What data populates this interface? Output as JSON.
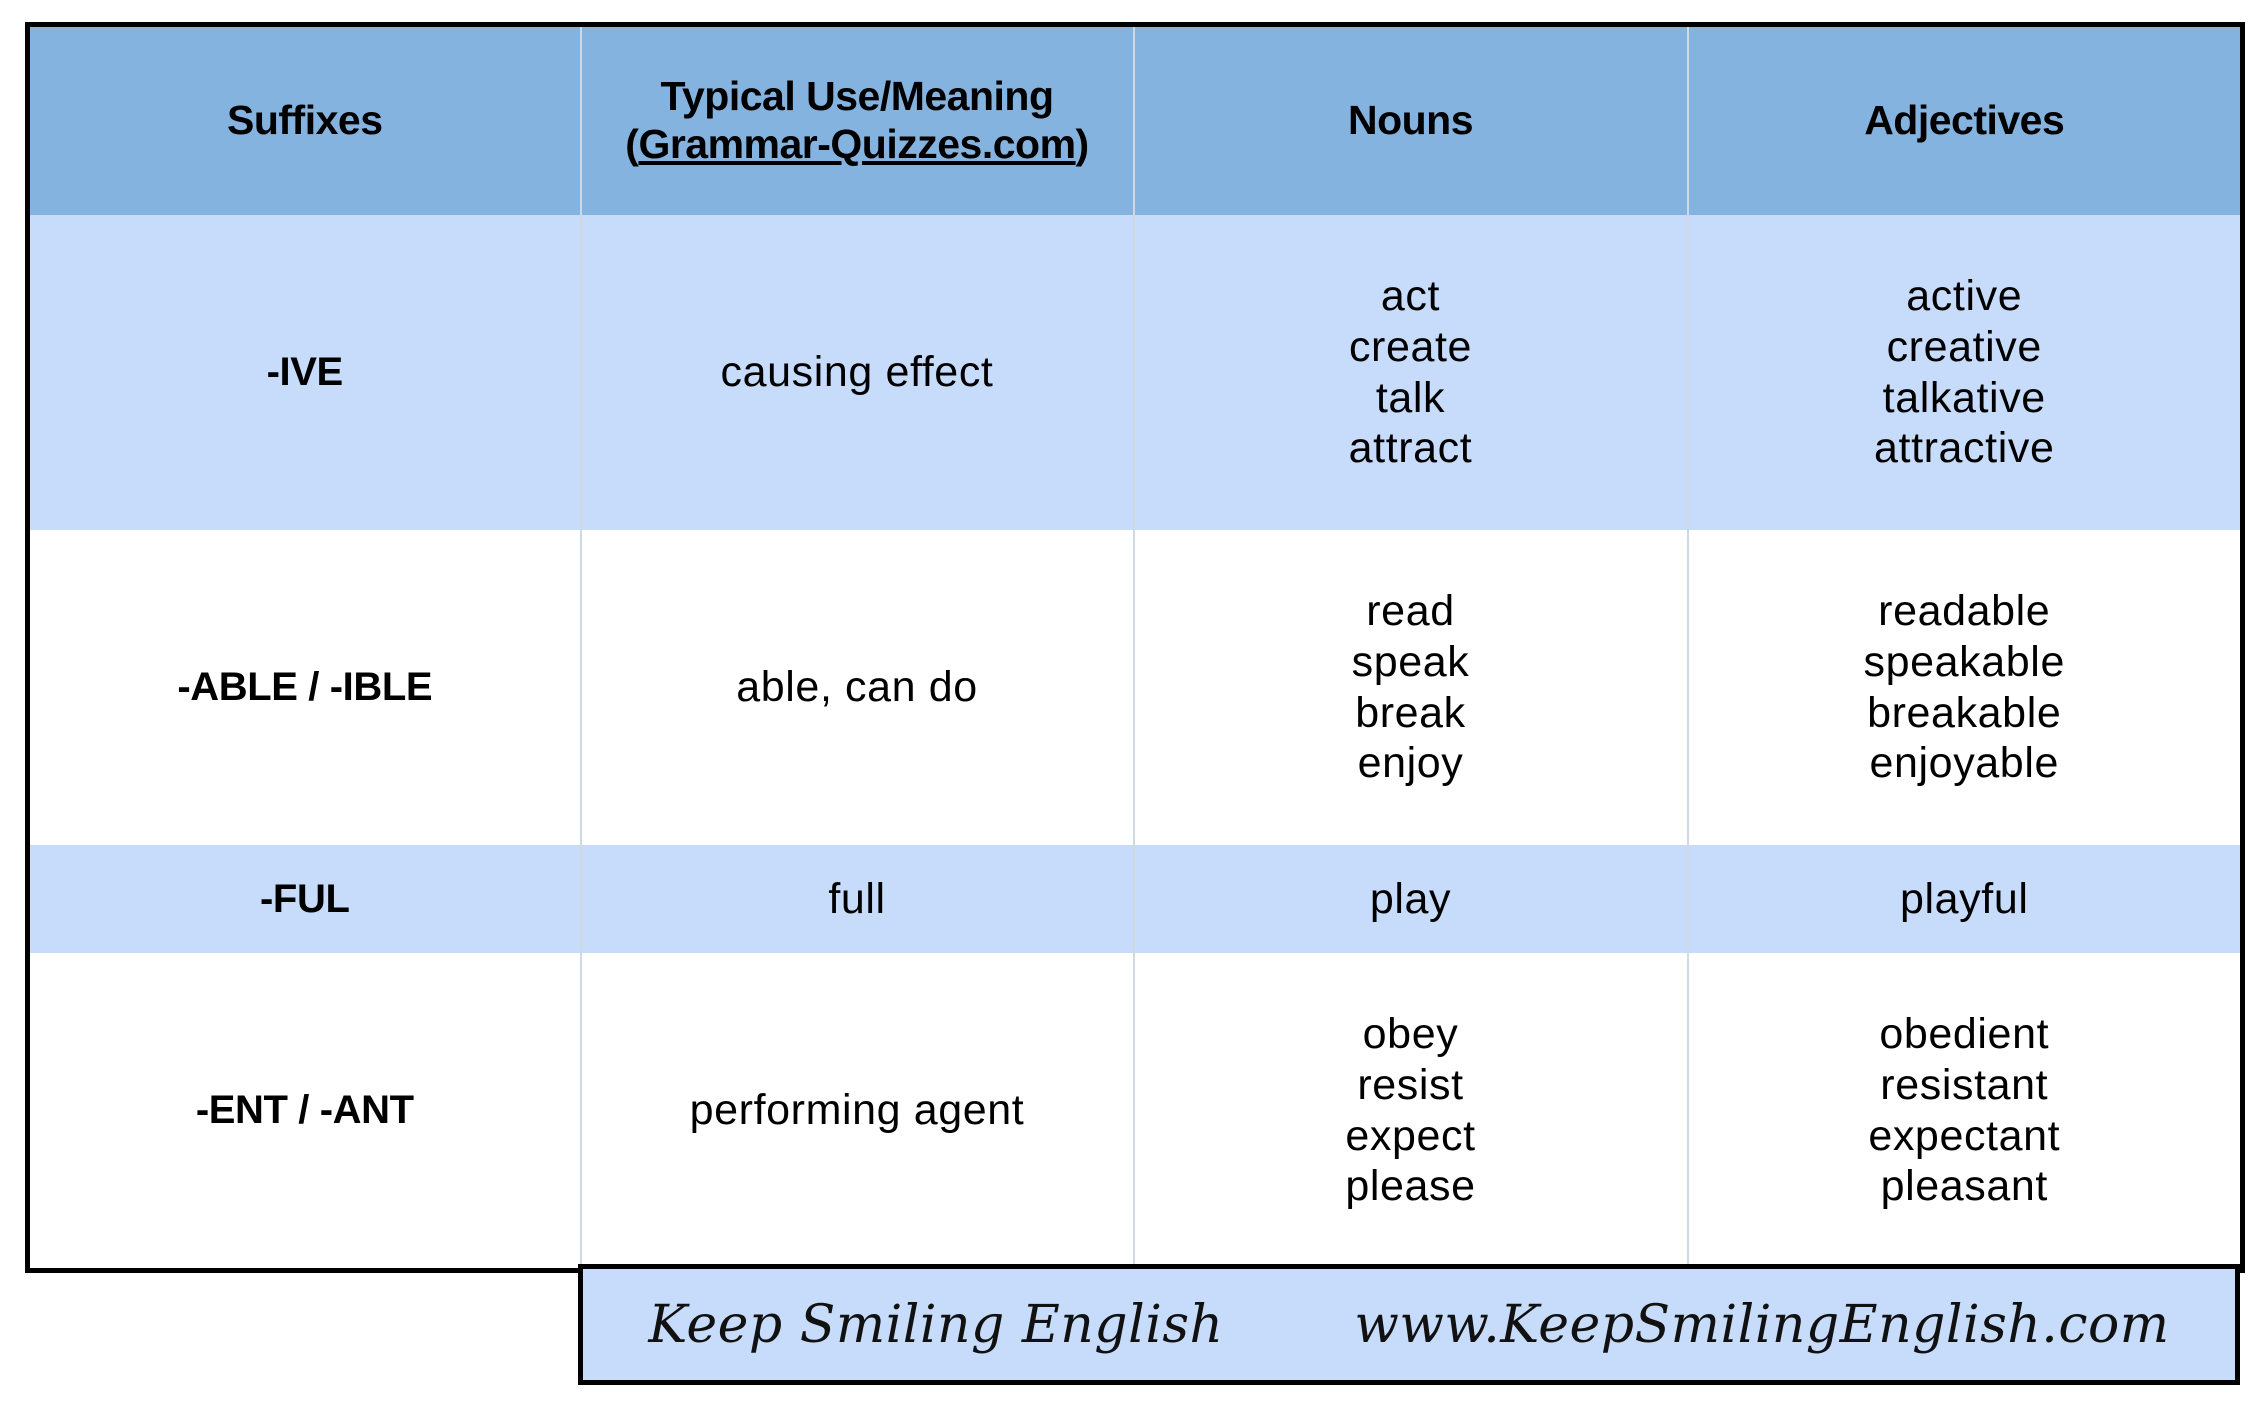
{
  "table": {
    "columns": [
      {
        "label": "Suffixes"
      },
      {
        "label": "Typical Use/Meaning",
        "sub_label": "(Grammar-Quizzes.com)"
      },
      {
        "label": "Nouns"
      },
      {
        "label": "Adjectives"
      }
    ],
    "rows": [
      {
        "suffix": "-IVE",
        "meaning": "causing effect",
        "nouns": [
          "act",
          "create",
          "talk",
          "attract"
        ],
        "adjectives": [
          "active",
          "creative",
          "talkative",
          "attractive"
        ]
      },
      {
        "suffix": "-ABLE / -IBLE",
        "meaning": "able, can do",
        "nouns": [
          "read",
          "speak",
          "break",
          "enjoy"
        ],
        "adjectives": [
          "readable",
          "speakable",
          "breakable",
          "enjoyable"
        ]
      },
      {
        "suffix": "-FUL",
        "meaning": "full",
        "nouns": [
          "play"
        ],
        "adjectives": [
          "playful"
        ]
      },
      {
        "suffix": "-ENT / -ANT",
        "meaning": "performing agent",
        "nouns": [
          "obey",
          "resist",
          "expect",
          "please"
        ],
        "adjectives": [
          "obedient",
          "resistant",
          "expectant",
          "pleasant"
        ]
      }
    ]
  },
  "footer": {
    "brand_name": "Keep Smiling English",
    "website": "www.KeepSmilingEnglish.com"
  },
  "colors": {
    "header_bg": "#85b3e0",
    "row_shade_bg": "#c7dcfb",
    "row_plain_bg": "#ffffff",
    "border": "#000000",
    "inner_divider": "#cfd9e6",
    "text": "#000000"
  }
}
